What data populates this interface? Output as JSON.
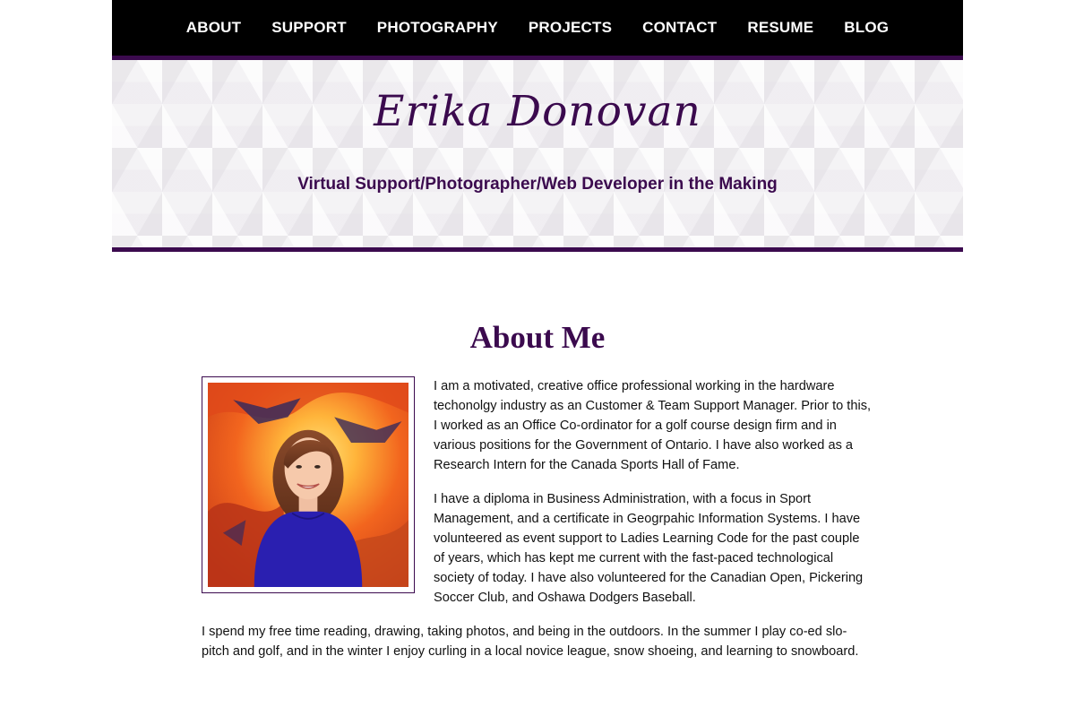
{
  "nav": {
    "items": [
      {
        "label": "ABOUT"
      },
      {
        "label": "SUPPORT"
      },
      {
        "label": "PHOTOGRAPHY"
      },
      {
        "label": "PROJECTS"
      },
      {
        "label": "CONTACT"
      },
      {
        "label": "RESUME"
      },
      {
        "label": "BLOG"
      }
    ]
  },
  "header": {
    "name": "Erika Donovan",
    "tagline": "Virtual Support/Photographer/Web Developer in the Making"
  },
  "about": {
    "heading": "About Me",
    "photo_icon": "profile-photo",
    "paragraphs": [
      "I am a motivated, creative office professional working in the hardware techonolgy industry as an Customer & Team Support Manager. Prior to this, I worked as an Office Co-ordinator for a golf course design firm and in various positions for the Government of Ontario. I have also worked as a Research Intern for the Canada Sports Hall of Fame.",
      "I have a diploma in Business Administration, with a focus in Sport Management, and a certificate in Geogrpahic Information Systems. I have volunteered as event support to Ladies Learning Code for the past couple of years, which has kept me current with the fast-paced technological society of today. I have also volunteered for the Canadian Open, Pickering Soccer Club, and Oshawa Dodgers Baseball.",
      "I spend my free time reading, drawing, taking photos, and being in the outdoors. In the summer I play co-ed slo-pitch and golf, and in the winter I enjoy curling in a local novice league, snow shoeing, and learning to snowboard."
    ]
  },
  "colors": {
    "accent": "#3b0a4e",
    "nav_bg": "#000000",
    "nav_text": "#ffffff"
  }
}
